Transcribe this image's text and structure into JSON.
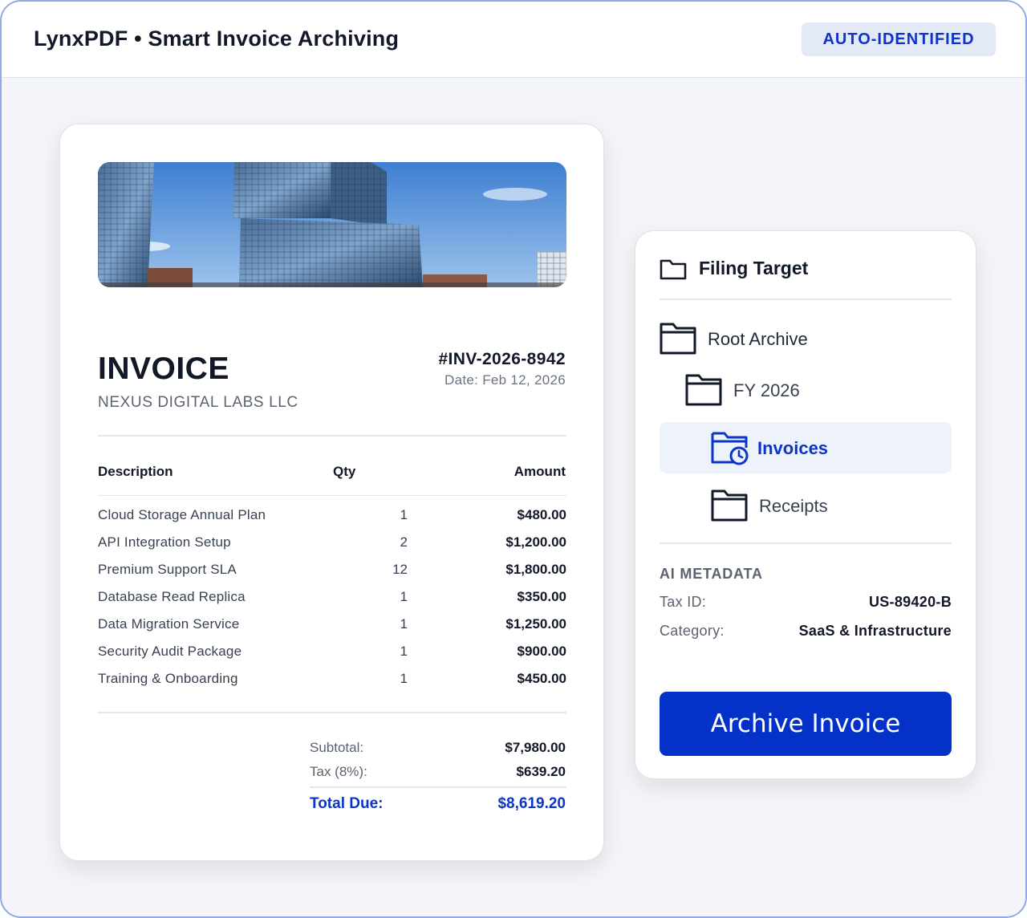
{
  "app": {
    "title": "LynxPDF • Smart Invoice Archiving",
    "badge": "AUTO-IDENTIFIED"
  },
  "invoice": {
    "image_icon": "office-building-photo",
    "title": "INVOICE",
    "company": "NEXUS DIGITAL LABS LLC",
    "number": "#INV-2026-8942",
    "date": "Date: Feb 12, 2026",
    "columns": {
      "description": "Description",
      "qty": "Qty",
      "amount": "Amount"
    },
    "items": [
      {
        "description": "Cloud Storage Annual Plan",
        "qty": "1",
        "amount": "$480.00"
      },
      {
        "description": "API Integration Setup",
        "qty": "2",
        "amount": "$1,200.00"
      },
      {
        "description": "Premium Support SLA",
        "qty": "12",
        "amount": "$1,800.00"
      },
      {
        "description": "Database Read Replica",
        "qty": "1",
        "amount": "$350.00"
      },
      {
        "description": "Data Migration Service",
        "qty": "1",
        "amount": "$1,250.00"
      },
      {
        "description": "Security Audit Package",
        "qty": "1",
        "amount": "$900.00"
      },
      {
        "description": "Training & Onboarding",
        "qty": "1",
        "amount": "$450.00"
      }
    ],
    "totals": {
      "subtotal_label": "Subtotal:",
      "subtotal": "$7,980.00",
      "tax_label": "Tax (8%):",
      "tax": "$639.20",
      "due_label": "Total Due:",
      "due": "$8,619.20"
    }
  },
  "filing": {
    "title": "Filing Target",
    "title_icon": "folder-outline-icon",
    "tree": [
      {
        "label": "Root Archive",
        "icon": "folder-icon",
        "selected": false
      },
      {
        "label": "FY 2026",
        "icon": "folder-icon",
        "selected": false
      },
      {
        "label": "Invoices",
        "icon": "folder-clock-icon",
        "selected": true
      },
      {
        "label": "Receipts",
        "icon": "folder-icon",
        "selected": false
      }
    ],
    "metadata": {
      "heading": "AI METADATA",
      "tax_id_label": "Tax ID:",
      "tax_id": "US-89420-B",
      "category_label": "Category:",
      "category": "SaaS & Infrastructure"
    },
    "button": "Archive Invoice"
  },
  "colors": {
    "accent": "#0432c8",
    "accent_text": "#0a35c8",
    "badge_bg": "#e4e9f8",
    "selected_bg": "#eef2fb",
    "frame_border": "#93a8e6"
  }
}
